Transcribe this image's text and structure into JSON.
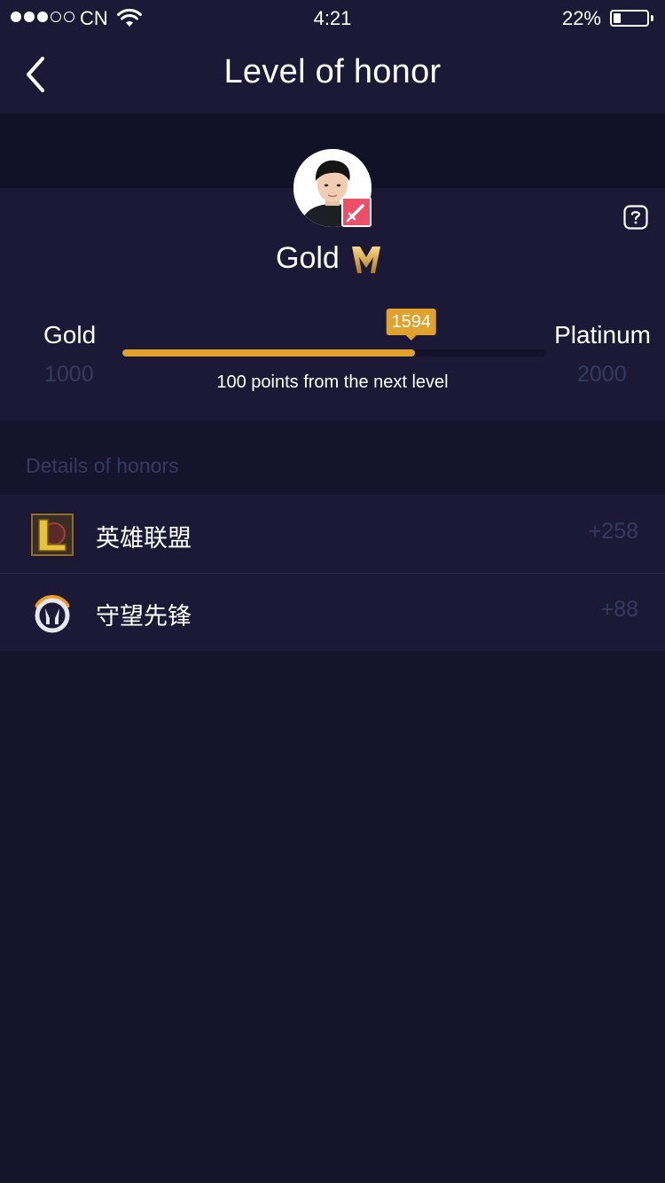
{
  "status_bar": {
    "carrier": "CN",
    "time": "4:21",
    "battery_percent": "22%",
    "battery_level": 0.22,
    "signal_bars": 3,
    "signal_total": 5
  },
  "nav": {
    "title": "Level of honor",
    "back_icon": "chevron-left-icon"
  },
  "profile": {
    "rank": "Gold",
    "medal_icon": "gold-rank-medal-icon",
    "badge_icon": "sword-icon",
    "help_icon": "help-icon"
  },
  "progress": {
    "current_tier": "Gold",
    "current_tier_points": "1000",
    "next_tier": "Platinum",
    "next_tier_points": "2000",
    "score": "1594",
    "fill_fraction": 0.69,
    "note": "100 points from the next level"
  },
  "details": {
    "header": "Details of honors",
    "items": [
      {
        "name": "英雄联盟",
        "points": "+258",
        "icon": "league-of-legends-icon"
      },
      {
        "name": "守望先锋",
        "points": "+88",
        "icon": "overwatch-icon"
      }
    ]
  },
  "colors": {
    "background": "#16142c",
    "card": "#1b1936",
    "accent_gold": "#e0a12d",
    "muted_text": "#353a5e",
    "badge_pink": "#ee4f68"
  }
}
